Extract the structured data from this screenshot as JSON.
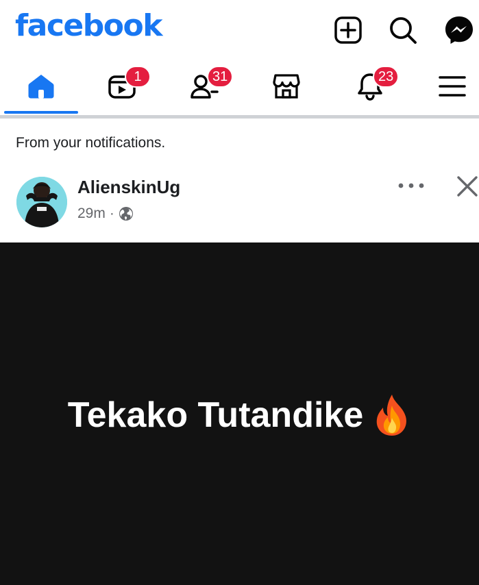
{
  "header": {
    "logo_text": "facebook",
    "icons": [
      "plus-square-icon",
      "search-icon",
      "messenger-icon"
    ]
  },
  "nav": {
    "items": [
      {
        "name": "home",
        "icon": "home-icon",
        "badge": null,
        "active": true
      },
      {
        "name": "video",
        "icon": "video-icon",
        "badge": "1"
      },
      {
        "name": "friends",
        "icon": "friends-icon",
        "badge": "31"
      },
      {
        "name": "marketplace",
        "icon": "marketplace-icon",
        "badge": null
      },
      {
        "name": "notifications",
        "icon": "bell-icon",
        "badge": "23"
      },
      {
        "name": "menu",
        "icon": "hamburger-menu-icon",
        "badge": null
      }
    ]
  },
  "notification_context": {
    "label": "From your notifications."
  },
  "post": {
    "author": "AlienskinUg",
    "time": "29m",
    "separator": "·",
    "audience_icon": "globe-icon",
    "text": "Tekako Tutandike",
    "emoji": "fire-emoji"
  },
  "colors": {
    "brand": "#1877f2",
    "badge": "#e41e3f",
    "post_background": "#121212"
  }
}
